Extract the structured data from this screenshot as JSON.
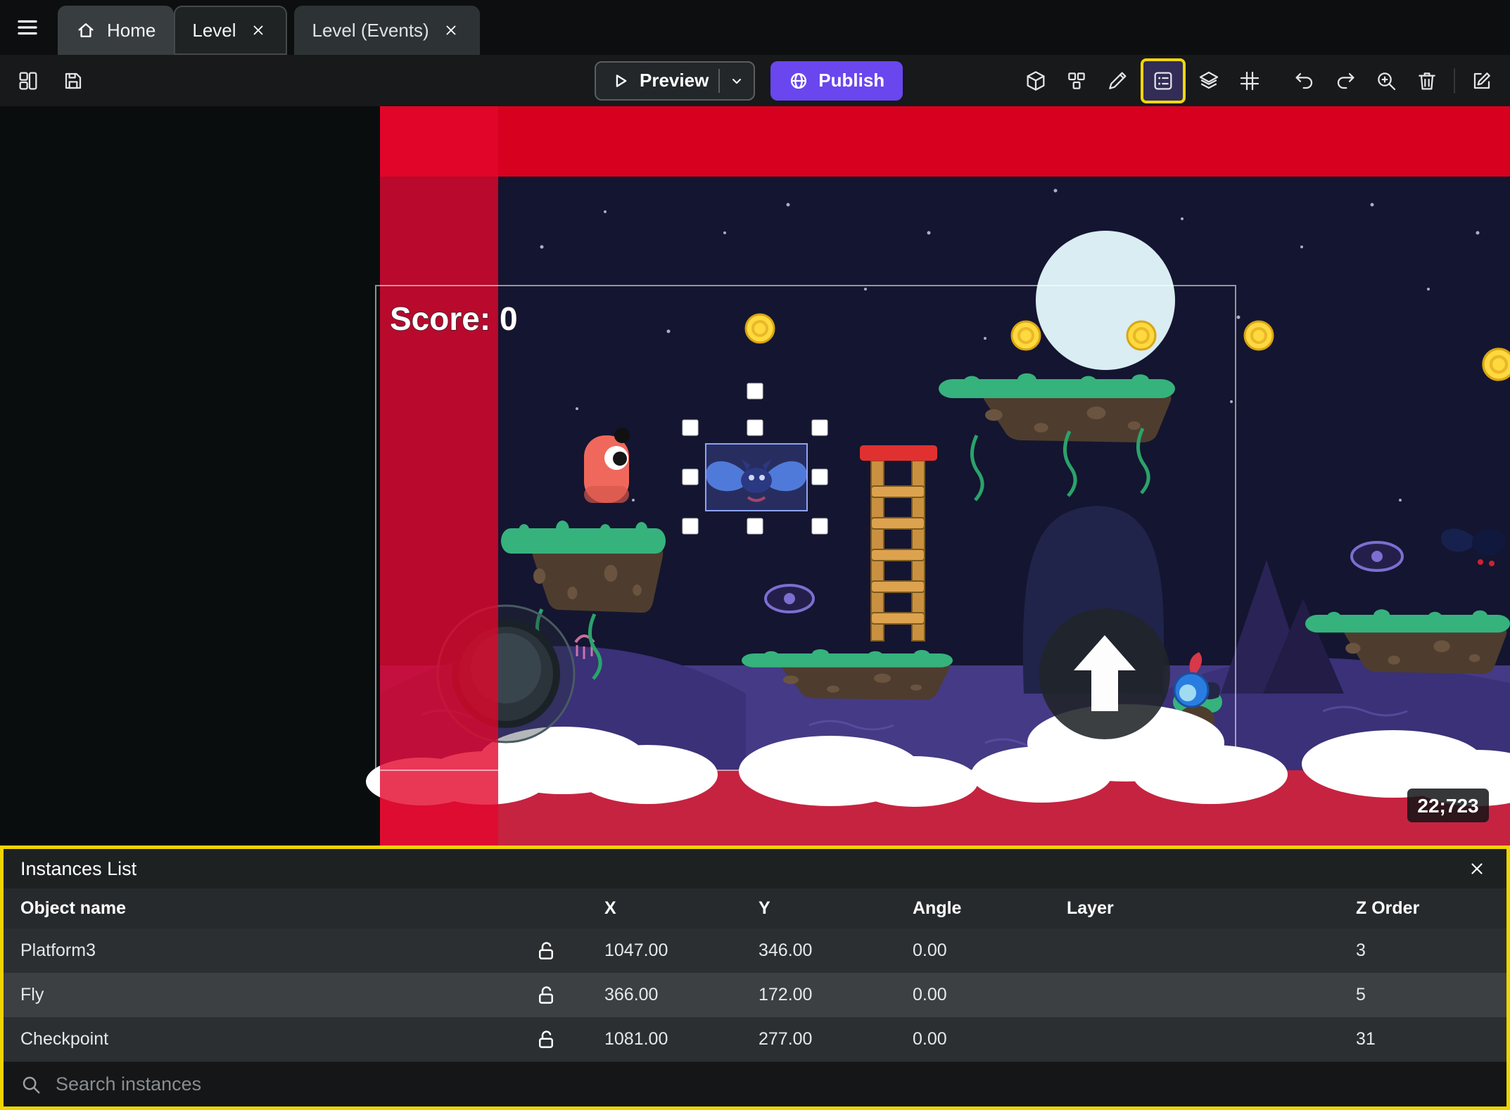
{
  "tabbar": {
    "tabs": [
      {
        "label": "Home"
      },
      {
        "label": "Level"
      },
      {
        "label": "Level (Events)"
      }
    ]
  },
  "toolbar": {
    "preview": "Preview",
    "publish": "Publish"
  },
  "canvas": {
    "score": "Score: 0",
    "coords": "22;723"
  },
  "panel": {
    "title": "Instances List",
    "columns": [
      "Object name",
      "X",
      "Y",
      "Angle",
      "Layer",
      "Z Order"
    ],
    "rows": [
      {
        "name": "Platform3",
        "x": "1047.00",
        "y": "346.00",
        "angle": "0.00",
        "layer": "",
        "z": "3"
      },
      {
        "name": "Fly",
        "x": "366.00",
        "y": "172.00",
        "angle": "0.00",
        "layer": "",
        "z": "5"
      },
      {
        "name": "Checkpoint",
        "x": "1081.00",
        "y": "277.00",
        "angle": "0.00",
        "layer": "",
        "z": "31"
      }
    ],
    "search_placeholder": "Search instances"
  },
  "colors": {
    "accent_purple": "#6a46ef",
    "highlight_yellow": "#f0d400",
    "red_band": "#e2062c",
    "sky": "#141530",
    "grass": "#36b27d"
  }
}
